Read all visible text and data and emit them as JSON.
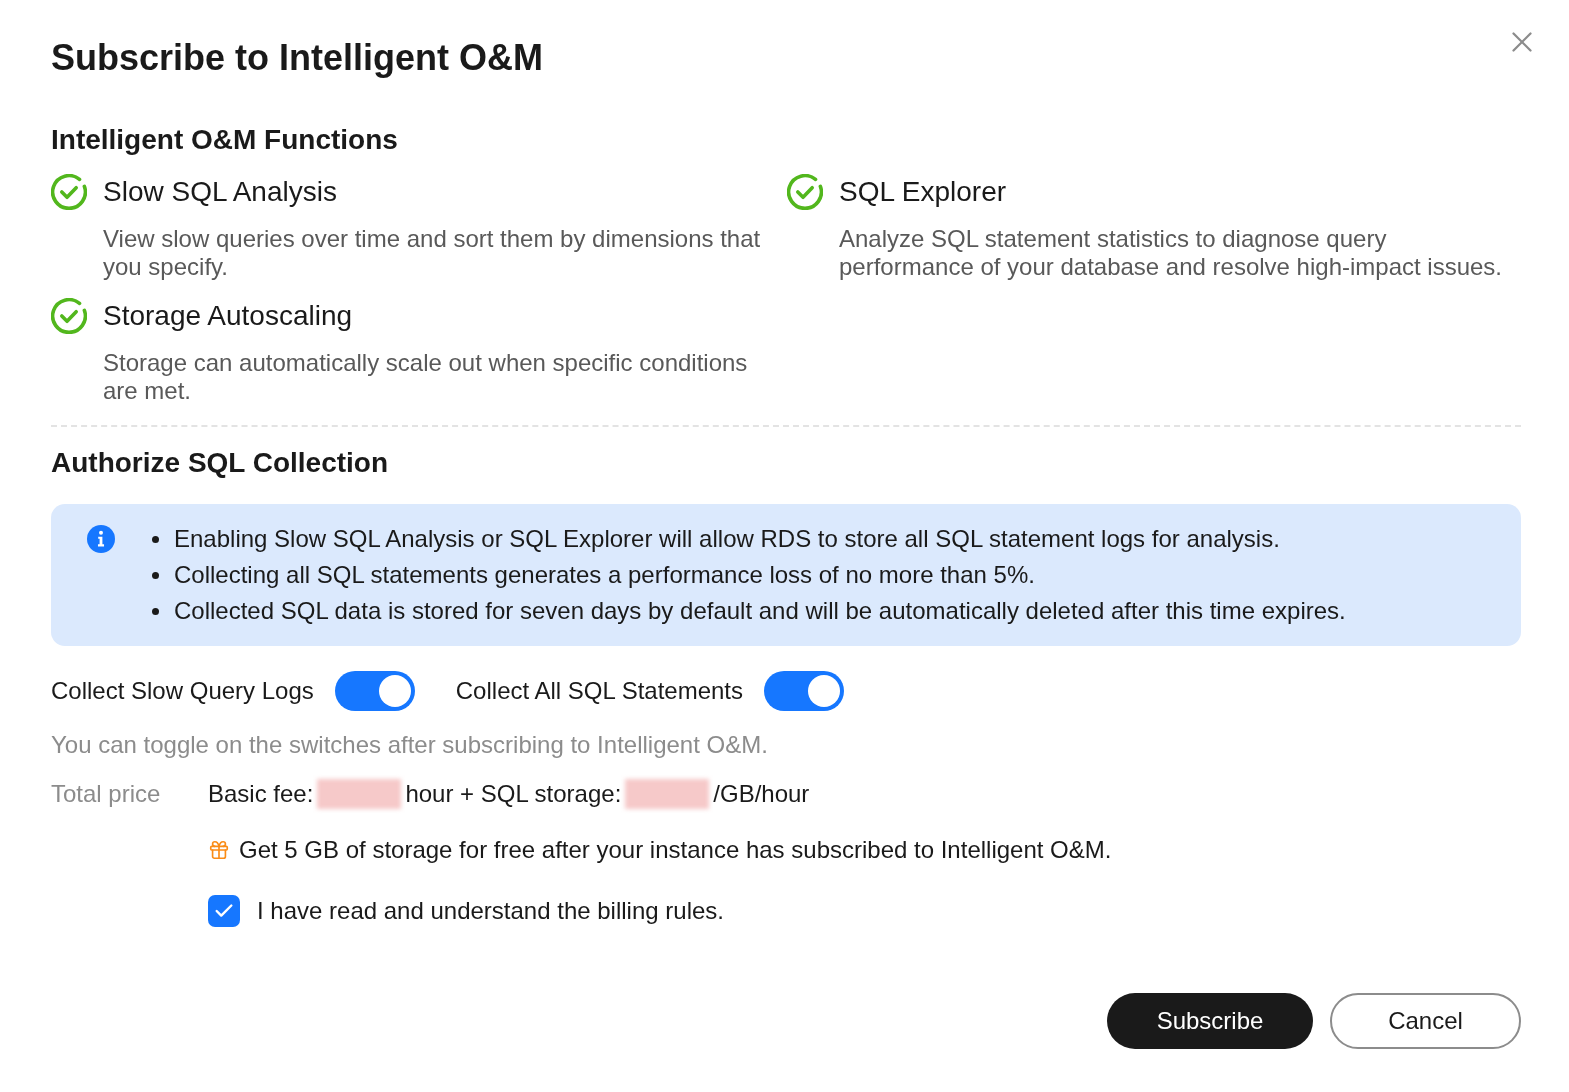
{
  "dialog": {
    "title": "Subscribe to Intelligent O&M"
  },
  "functions": {
    "heading": "Intelligent O&M Functions",
    "items": [
      {
        "name": "Slow SQL Analysis",
        "description": "View slow queries over time and sort them by dimensions that you specify."
      },
      {
        "name": "SQL Explorer",
        "description": "Analyze SQL statement statistics to diagnose query performance of your database and resolve high-impact issues."
      },
      {
        "name": "Storage Autoscaling",
        "description": "Storage can automatically scale out when specific conditions are met."
      }
    ]
  },
  "authorization": {
    "heading": "Authorize SQL Collection",
    "notice": [
      "Enabling Slow SQL Analysis or SQL Explorer will allow RDS to store all SQL statement logs for analysis.",
      "Collecting all SQL statements generates a performance loss of no more than 5%.",
      "Collected SQL data is stored for seven days by default and will be automatically deleted after this time expires."
    ],
    "switches": [
      {
        "label": "Collect Slow Query Logs",
        "on": true
      },
      {
        "label": "Collect All SQL Statements",
        "on": true
      }
    ],
    "hint": "You can toggle on the switches after subscribing to Intelligent O&M."
  },
  "price": {
    "label": "Total price",
    "parts": [
      {
        "kind": "text",
        "text": "Basic fee:"
      },
      {
        "kind": "redacted"
      },
      {
        "kind": "text",
        "text": "hour + SQL storage:"
      },
      {
        "kind": "redacted"
      },
      {
        "kind": "text",
        "text": "/GB/hour"
      }
    ],
    "promo": "Get 5 GB of storage for free after your instance has subscribed to Intelligent O&M."
  },
  "agreement": {
    "label": "I have read and understand the billing rules.",
    "checked": true
  },
  "buttons": [
    {
      "label": "Subscribe",
      "kind": "primary"
    },
    {
      "label": "Cancel",
      "kind": "secondary"
    }
  ]
}
